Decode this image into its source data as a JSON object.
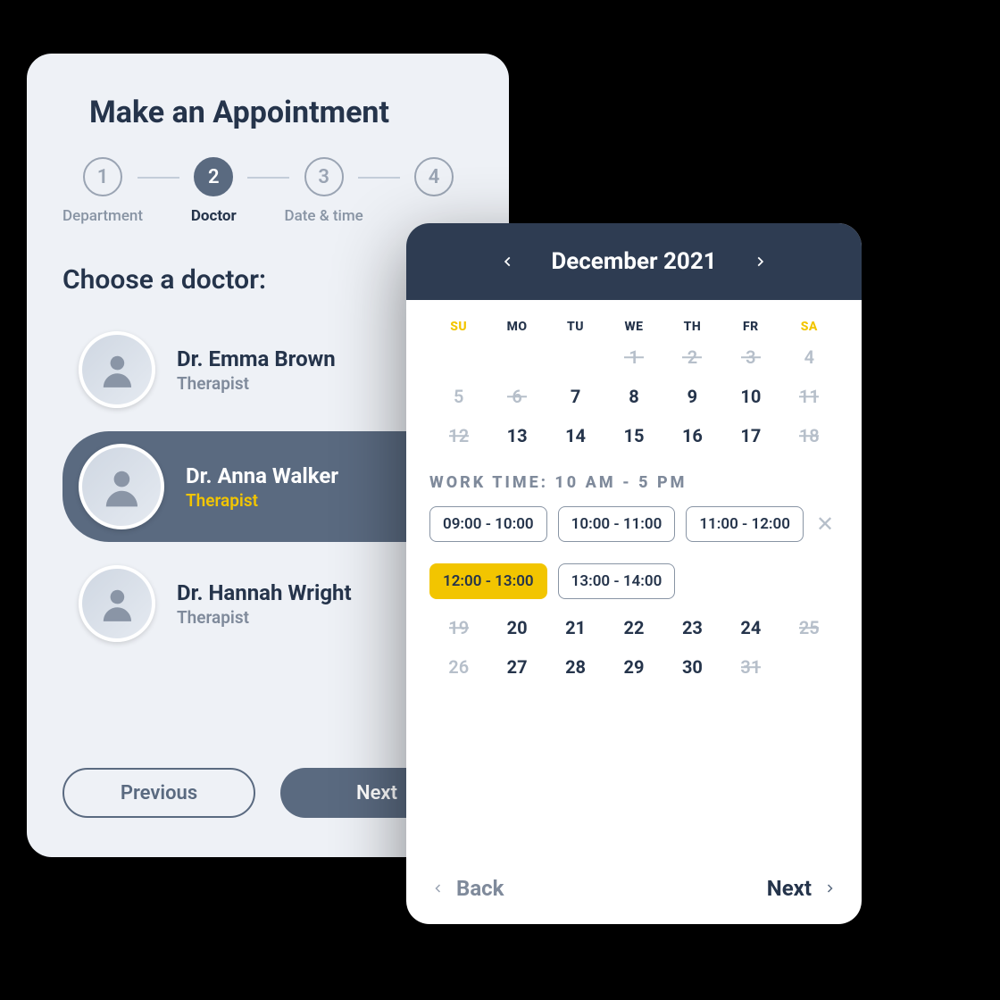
{
  "wizard": {
    "title": "Make an Appointment",
    "steps": [
      {
        "num": "1",
        "label": "Department",
        "active": false
      },
      {
        "num": "2",
        "label": "Doctor",
        "active": true
      },
      {
        "num": "3",
        "label": "Date & time",
        "active": false
      },
      {
        "num": "4",
        "label": "",
        "active": false
      }
    ],
    "section_heading": "Choose a doctor:",
    "doctors": [
      {
        "name": "Dr. Emma Brown",
        "role": "Therapist",
        "selected": false
      },
      {
        "name": "Dr. Anna Walker",
        "role": "Therapist",
        "selected": true
      },
      {
        "name": "Dr. Hannah Wright",
        "role": "Therapist",
        "selected": false
      }
    ],
    "prev_label": "Previous",
    "next_label": "Next"
  },
  "calendar": {
    "month_label": "December 2021",
    "dow": [
      "SU",
      "MO",
      "TU",
      "WE",
      "TH",
      "FR",
      "SA"
    ],
    "rows_top": [
      [
        {
          "d": "",
          "state": "empty"
        },
        {
          "d": "",
          "state": "empty"
        },
        {
          "d": "",
          "state": "empty"
        },
        {
          "d": "1",
          "state": "dim-strike"
        },
        {
          "d": "2",
          "state": "dim-strike"
        },
        {
          "d": "3",
          "state": "dim-strike"
        },
        {
          "d": "4",
          "state": "dim"
        }
      ],
      [
        {
          "d": "5",
          "state": "dim"
        },
        {
          "d": "6",
          "state": "dim-strike"
        },
        {
          "d": "7",
          "state": "on"
        },
        {
          "d": "8",
          "state": "on"
        },
        {
          "d": "9",
          "state": "on"
        },
        {
          "d": "10",
          "state": "on"
        },
        {
          "d": "11",
          "state": "dim-strike"
        }
      ],
      [
        {
          "d": "12",
          "state": "dim-strike"
        },
        {
          "d": "13",
          "state": "on"
        },
        {
          "d": "14",
          "state": "on"
        },
        {
          "d": "15",
          "state": "on"
        },
        {
          "d": "16",
          "state": "on"
        },
        {
          "d": "17",
          "state": "on"
        },
        {
          "d": "18",
          "state": "dim-strike"
        }
      ]
    ],
    "worktime_label": "WORK TIME: 10 AM - 5 PM",
    "slots": [
      {
        "label": "09:00 - 10:00",
        "selected": false
      },
      {
        "label": "10:00 - 11:00",
        "selected": false
      },
      {
        "label": "11:00 - 12:00",
        "selected": false
      },
      {
        "label": "12:00 - 13:00",
        "selected": true
      },
      {
        "label": "13:00 - 14:00",
        "selected": false
      }
    ],
    "rows_bottom": [
      [
        {
          "d": "19",
          "state": "dim-strike"
        },
        {
          "d": "20",
          "state": "on"
        },
        {
          "d": "21",
          "state": "on"
        },
        {
          "d": "22",
          "state": "on"
        },
        {
          "d": "23",
          "state": "on"
        },
        {
          "d": "24",
          "state": "on"
        },
        {
          "d": "25",
          "state": "dim-strike"
        }
      ],
      [
        {
          "d": "26",
          "state": "dim"
        },
        {
          "d": "27",
          "state": "on"
        },
        {
          "d": "28",
          "state": "on"
        },
        {
          "d": "29",
          "state": "on"
        },
        {
          "d": "30",
          "state": "on"
        },
        {
          "d": "31",
          "state": "dim-strike"
        },
        {
          "d": "",
          "state": "empty"
        }
      ]
    ],
    "back_label": "Back",
    "next_label": "Next"
  }
}
